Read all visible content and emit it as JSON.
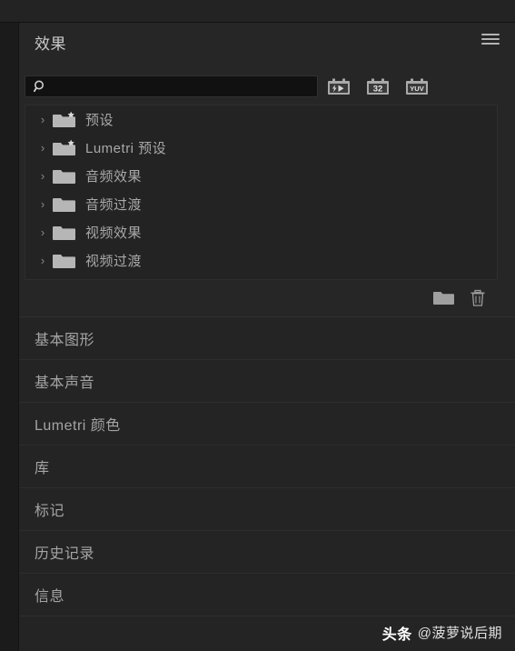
{
  "panel": {
    "title": "效果",
    "menu_icon": "hamburger-menu-icon"
  },
  "search": {
    "value": "",
    "placeholder": "",
    "icon": "search-icon"
  },
  "filters": [
    {
      "id": "accelerated",
      "label": "",
      "icon": "accelerated-effects-icon"
    },
    {
      "id": "bit32",
      "label": "32",
      "icon": "32-bit-color-icon"
    },
    {
      "id": "yuv",
      "label": "YUV",
      "icon": "yuv-color-icon"
    }
  ],
  "tree": {
    "items": [
      {
        "label": "预设",
        "icon": "folder-star-icon",
        "expander": "›"
      },
      {
        "label": "Lumetri 预设",
        "icon": "folder-star-icon",
        "expander": "›"
      },
      {
        "label": "音频效果",
        "icon": "folder-icon",
        "expander": "›"
      },
      {
        "label": "音频过渡",
        "icon": "folder-icon",
        "expander": "›"
      },
      {
        "label": "视频效果",
        "icon": "folder-icon",
        "expander": "›"
      },
      {
        "label": "视频过渡",
        "icon": "folder-icon",
        "expander": "›"
      }
    ]
  },
  "tree_toolbar": {
    "new_folder_icon": "new-folder-icon",
    "delete_icon": "trash-icon"
  },
  "panel_list": {
    "items": [
      {
        "label": "基本图形"
      },
      {
        "label": "基本声音"
      },
      {
        "label": "Lumetri 颜色"
      },
      {
        "label": "库"
      },
      {
        "label": "标记"
      },
      {
        "label": "历史记录"
      },
      {
        "label": "信息"
      }
    ]
  },
  "watermark": {
    "brand": "头条",
    "handle": "@菠萝说后期"
  },
  "colors": {
    "panel_bg": "#262626",
    "list_bg": "#232323",
    "text": "#a8a8a8",
    "title_text": "#c8c8c8",
    "search_bg": "#111111"
  }
}
